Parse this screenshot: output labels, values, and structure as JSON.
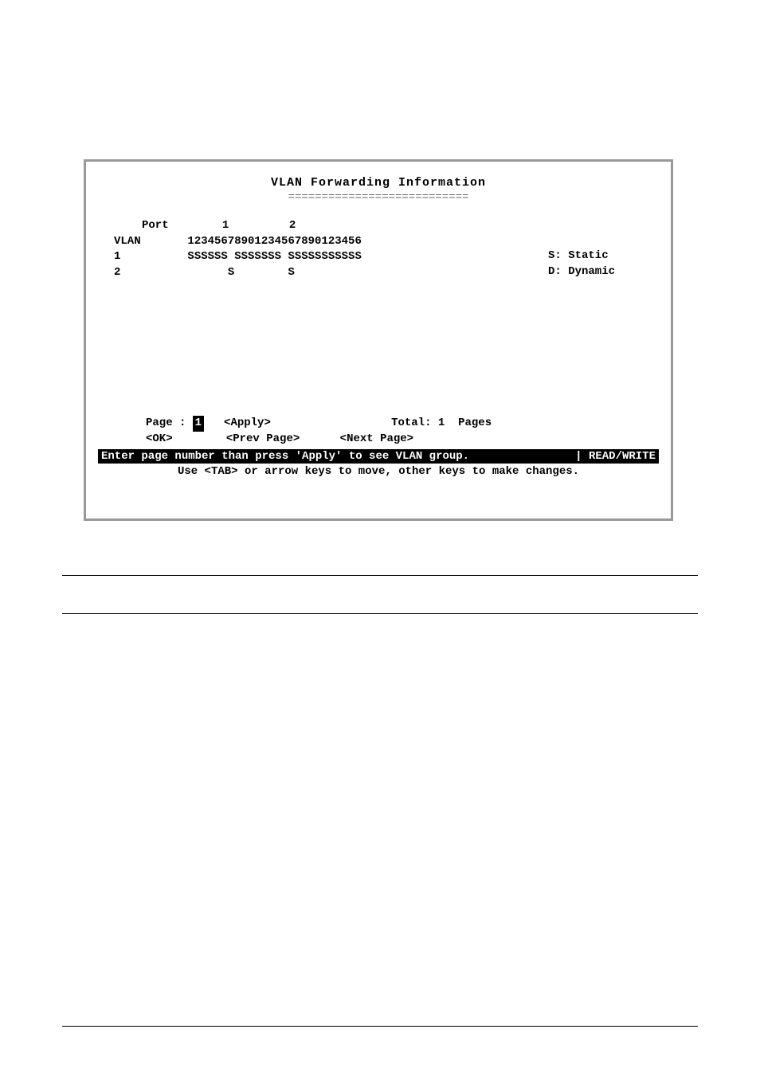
{
  "title": "VLAN Forwarding Information",
  "underline": "===========================",
  "header": {
    "port_label": "Port",
    "port_tens": "        1         2",
    "vlan_label": "VLAN",
    "port_ones": "12345678901234567890123456"
  },
  "rows": [
    {
      "vlan": "1",
      "ports": "SSSSSS SSSSSSS SSSSSSSSSSS"
    },
    {
      "vlan": "2",
      "ports": "      S        S"
    }
  ],
  "legend": {
    "static": "S: Static",
    "dynamic": "D: Dynamic"
  },
  "pagination": {
    "page_label": "Page :",
    "page_value": "1",
    "apply_label": "<Apply>",
    "total_label": "Total: 1  Pages",
    "ok_label": "<OK>",
    "prev_label": "<Prev Page>",
    "next_label": "<Next Page>"
  },
  "status": {
    "message": "Enter page number than press 'Apply' to see VLAN group.",
    "mode": "| READ/WRITE"
  },
  "help": "Use <TAB> or arrow keys to move, other keys to make changes."
}
